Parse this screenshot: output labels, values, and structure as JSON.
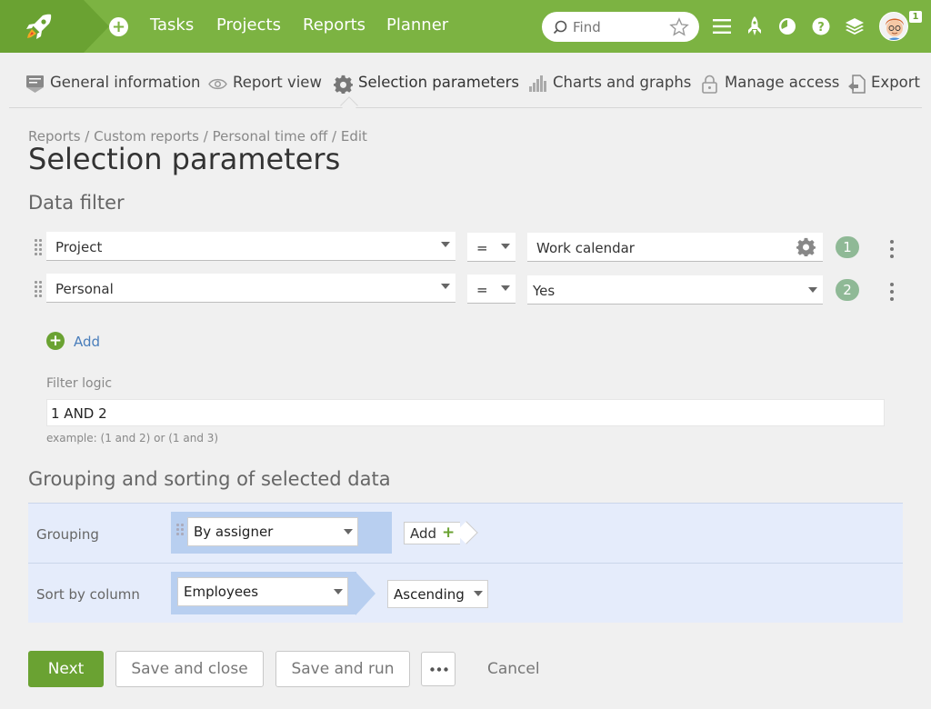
{
  "topbar": {
    "nav": [
      "Tasks",
      "Projects",
      "Reports",
      "Planner"
    ],
    "search_placeholder": "Find",
    "notification_count": "1",
    "brand_color": "#7cb342"
  },
  "tabs": [
    {
      "label": "General information",
      "icon": "document-icon"
    },
    {
      "label": "Report view",
      "icon": "eye-icon"
    },
    {
      "label": "Selection parameters",
      "icon": "gear-icon",
      "active": true
    },
    {
      "label": "Charts and graphs",
      "icon": "bar-chart-icon"
    },
    {
      "label": "Manage access",
      "icon": "lock-icon"
    },
    {
      "label": "Export",
      "icon": "export-icon"
    }
  ],
  "breadcrumb": "Reports / Custom reports / Personal time off / Edit",
  "page_title": "Selection parameters",
  "data_filter": {
    "title": "Data filter",
    "rows": [
      {
        "field": "Project",
        "operator": "=",
        "value": "Work calendar",
        "index": "1"
      },
      {
        "field": "Personal",
        "operator": "=",
        "value": "Yes",
        "index": "2"
      }
    ],
    "add_label": "Add",
    "logic_label": "Filter logic",
    "logic_value": "1 AND 2",
    "logic_hint": "example: (1 and 2) or (1 and 3)"
  },
  "grouping": {
    "title": "Grouping and sorting of selected data",
    "grouping_label": "Grouping",
    "grouping_value": "By assigner",
    "add_label": "Add",
    "sort_label": "Sort by column",
    "sort_value": "Employees",
    "order_value": "Ascending"
  },
  "footer": {
    "next": "Next",
    "save_close": "Save and close",
    "save_run": "Save and run",
    "cancel": "Cancel"
  }
}
